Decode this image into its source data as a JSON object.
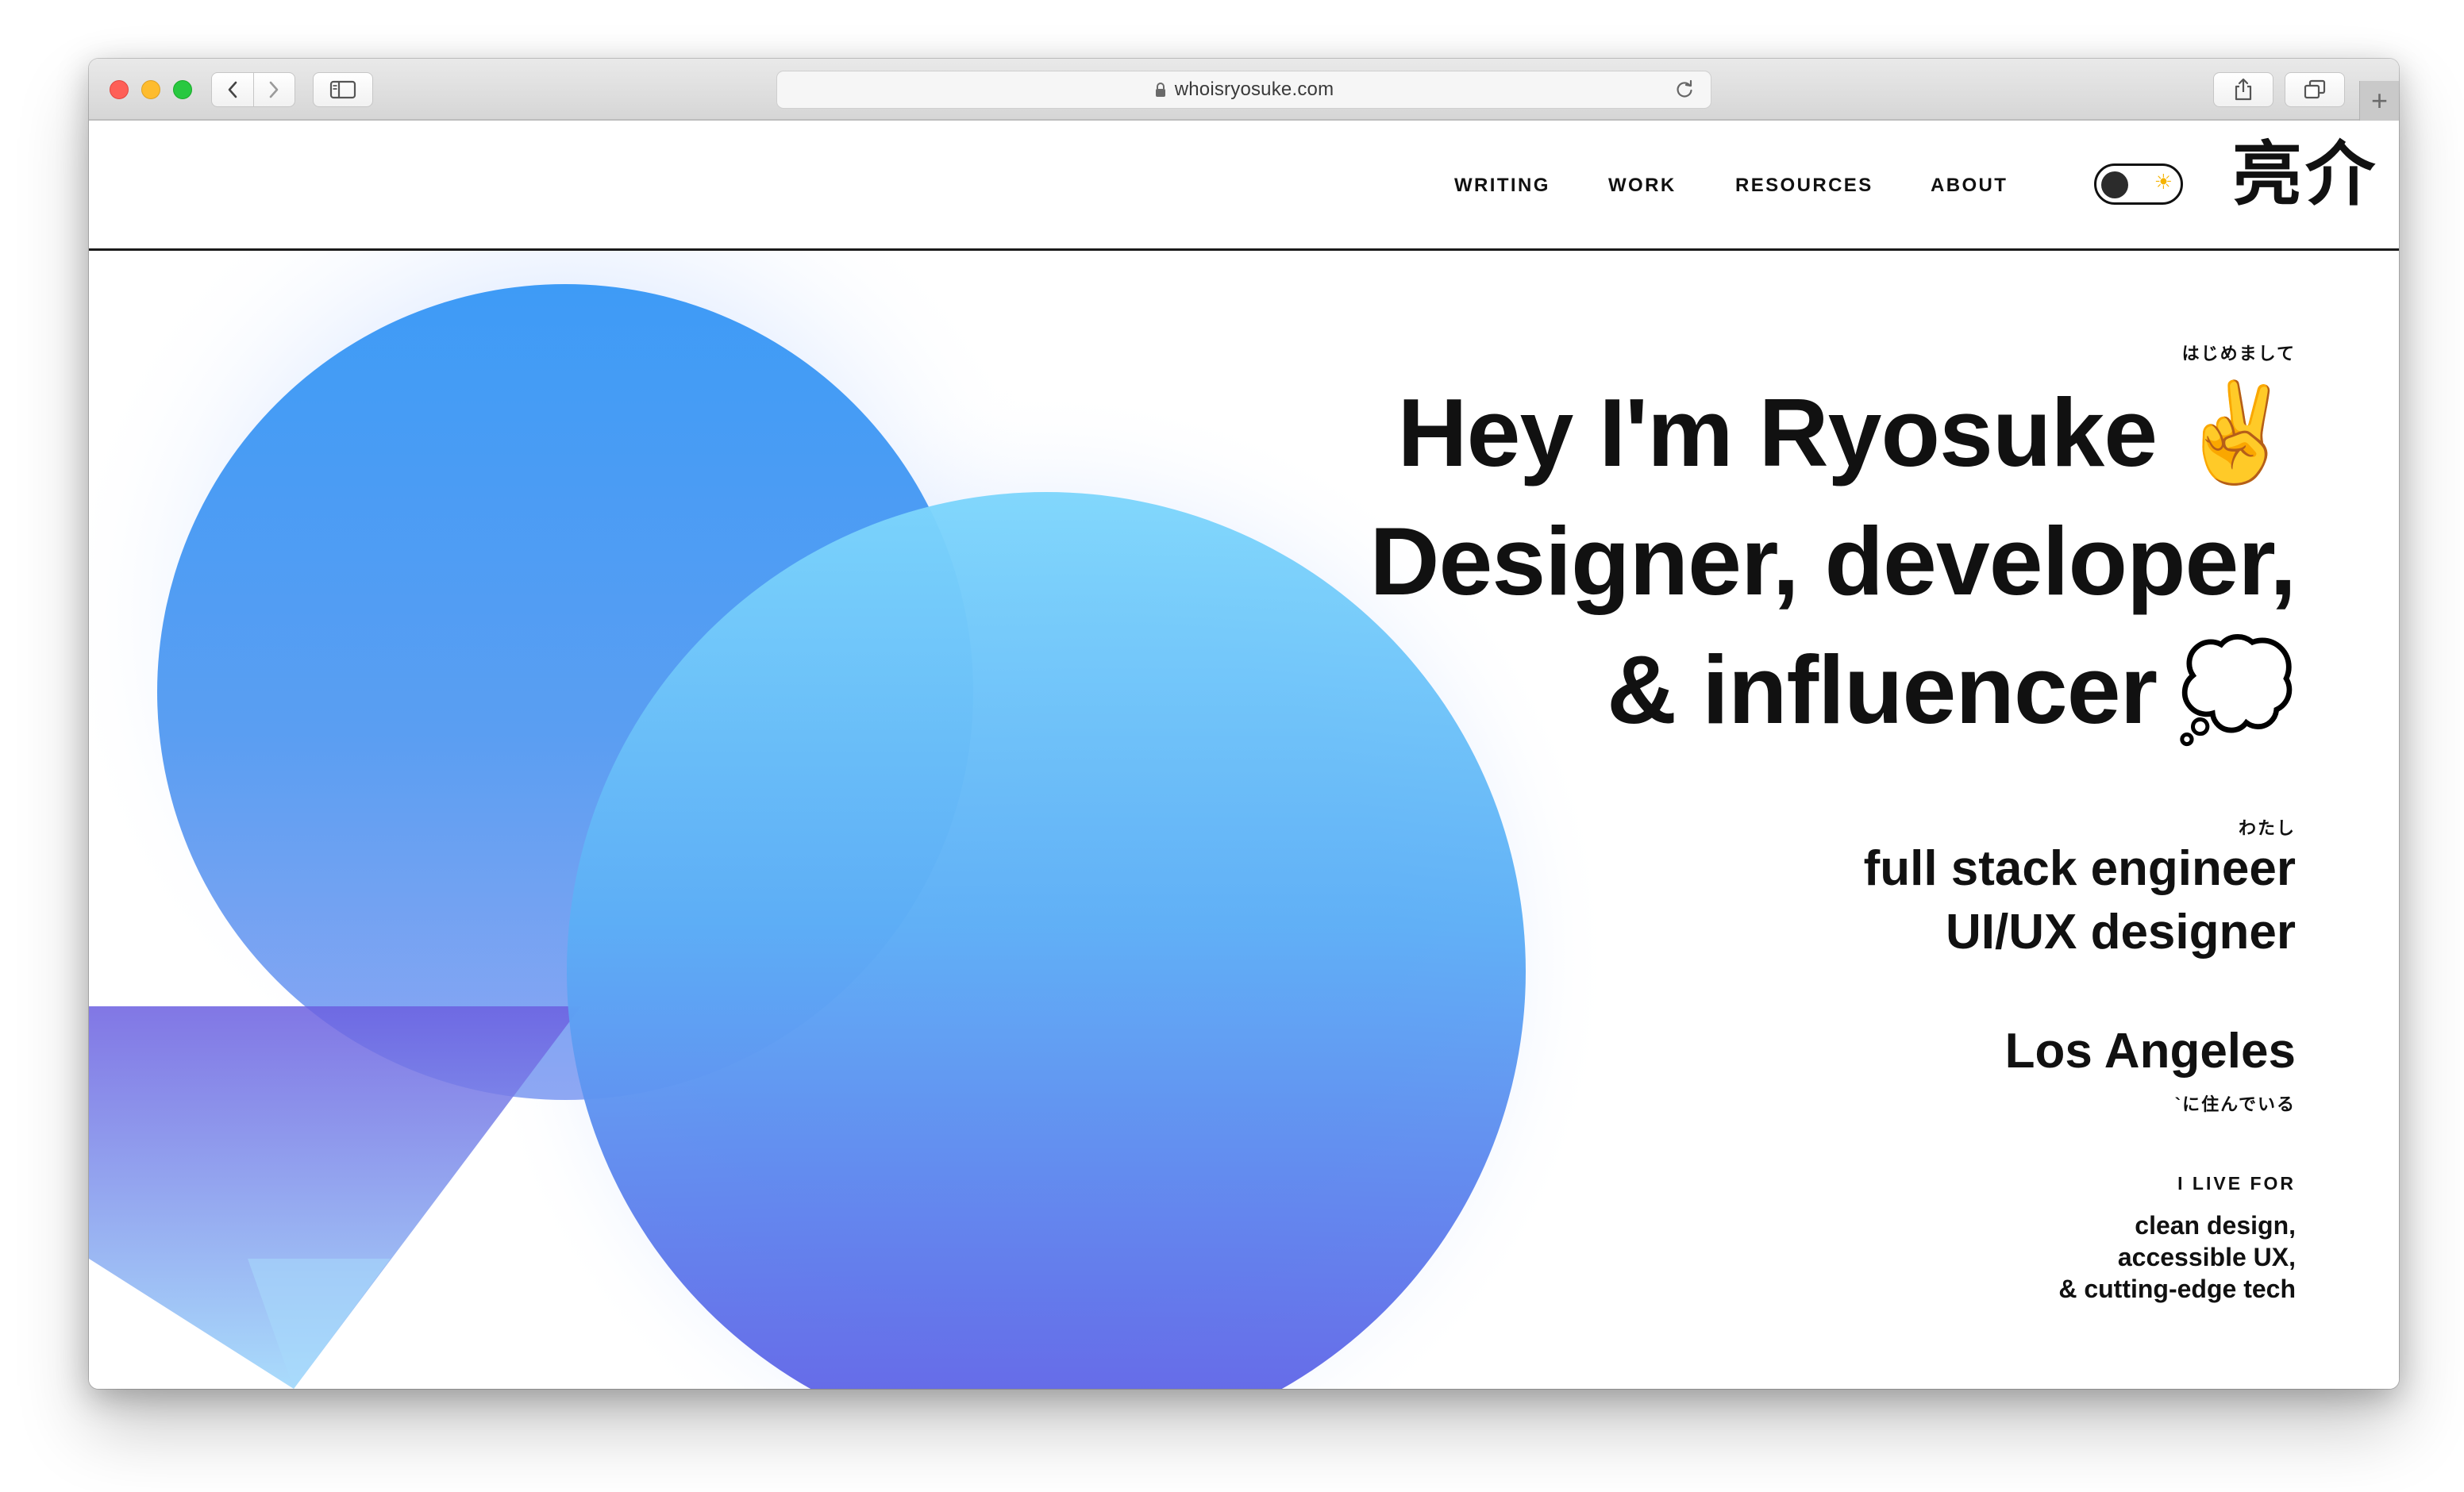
{
  "browser": {
    "url": "whoisryosuke.com",
    "new_tab_label": "+"
  },
  "icons": {
    "back": "chevron-left-icon",
    "forward": "chevron-right-icon",
    "sidebar": "sidebar-icon",
    "lock": "lock-icon",
    "reload": "reload-icon",
    "share": "share-icon",
    "tabs": "tabs-overview-icon",
    "sun": "sun-icon"
  },
  "site": {
    "logo": "亮介",
    "nav": {
      "writing": "WRITING",
      "work": "WORK",
      "resources": "RESOURCES",
      "about": "ABOUT"
    },
    "theme_toggle": {
      "sun_glyph": "☀"
    }
  },
  "hero": {
    "furigana_intro": "はじめまして",
    "line1": "Hey I'm Ryosuke",
    "line1_emoji": "✌️",
    "line2": "Designer, developer,",
    "line3": "& influencer",
    "line3_emoji": "💭",
    "furigana_roles": "わたし",
    "role1": "full stack engineer",
    "role2": "UI/UX designer",
    "location": "Los Angeles",
    "furigana_location": "`に住んでいる",
    "live_for_label": "I LIVE FOR",
    "live_for": [
      "clean design,",
      "accessible UX,",
      "& cutting-edge tech"
    ]
  },
  "colors": {
    "text": "#111111",
    "circle_blue": "#3f9df6",
    "circle_light_blue": "#7ad2fb",
    "indigo": "#6561e6",
    "triangle_top": "#6c5fe0",
    "triangle_bottom": "#9ed4fb",
    "glow": "#cfe2ff"
  }
}
